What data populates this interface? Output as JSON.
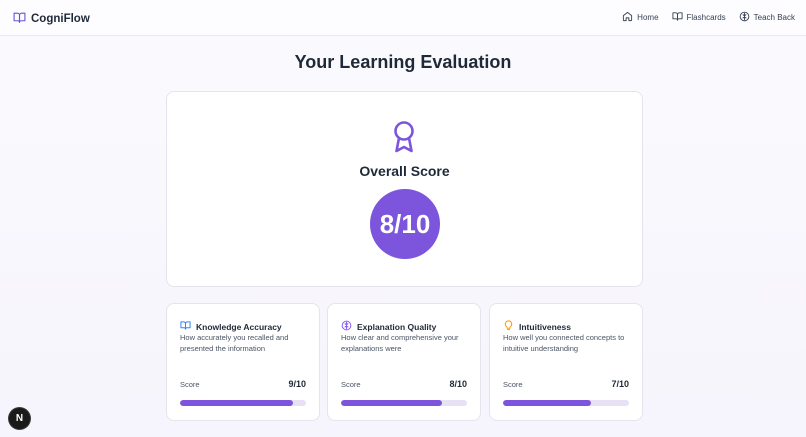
{
  "header": {
    "brand": "CogniFlow",
    "nav": [
      {
        "label": "Home",
        "icon": "home-icon"
      },
      {
        "label": "Flashcards",
        "icon": "book-icon"
      },
      {
        "label": "Teach Back",
        "icon": "brain-icon"
      }
    ]
  },
  "main": {
    "title": "Your Learning Evaluation",
    "overall": {
      "label": "Overall Score",
      "score": "8/10",
      "icon": "award-icon",
      "accent": "#7c55dc"
    },
    "metrics": [
      {
        "title": "Knowledge Accuracy",
        "icon": "book-icon",
        "icon_color": "#3b82f6",
        "description": "How accurately you recalled and presented the information",
        "score_label": "Score",
        "score": "9/10",
        "progress": 0.9
      },
      {
        "title": "Explanation Quality",
        "icon": "brain-icon",
        "icon_color": "#8b5cf6",
        "description": "How clear and comprehensive your explanations were",
        "score_label": "Score",
        "score": "8/10",
        "progress": 0.8
      },
      {
        "title": "Intuitiveness",
        "icon": "lightbulb-icon",
        "icon_color": "#f59e0b",
        "description": "How well you connected concepts to intuitive understanding",
        "score_label": "Score",
        "score": "7/10",
        "progress": 0.7
      }
    ]
  },
  "dev_badge": {
    "label": "N"
  }
}
